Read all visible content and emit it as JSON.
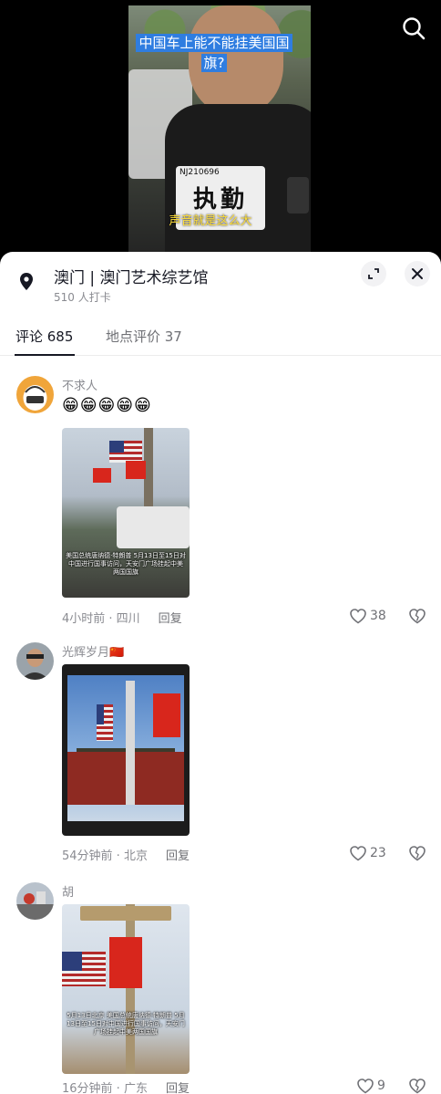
{
  "video": {
    "title": "中国车上能不能挂美国国旗?",
    "subtitle": "声音就是这么大",
    "badge_text": "执勤",
    "badge_tag": "NJ210696"
  },
  "location": {
    "title": "澳门 | 澳门艺术综艺馆",
    "checkins": "510 人打卡"
  },
  "tabs": [
    {
      "label": "评论 685",
      "active": true
    },
    {
      "label": "地点评价 37",
      "active": false
    }
  ],
  "comments": [
    {
      "user": "不求人",
      "text": "😁😁😁😁😁",
      "image_caption": "美国总统唐纳德·特朗普 5月13日至15日对中国进行国事访问，天安门广场挂起中美两国国旗",
      "time_place": "4小时前 · 四川",
      "reply": "回复",
      "likes": "38"
    },
    {
      "user": "光辉岁月🇨🇳",
      "text": "",
      "image_caption": "",
      "time_place": "54分钟前 · 北京",
      "reply": "回复",
      "likes": "23"
    },
    {
      "user": "胡",
      "text": "",
      "image_caption": "5月13日北京 美国总统唐纳德·特朗普 5月13日至15日对中国进行国事访问，天安门广场挂起中美两国国旗",
      "time_place": "16分钟前 · 广东",
      "reply": "回复",
      "likes": "9"
    }
  ],
  "colors": {
    "highlight_blue": "#2f7de0",
    "subtitle_yellow": "#ffdf3a",
    "text_primary": "#161823",
    "text_secondary": "#8a8b91"
  }
}
